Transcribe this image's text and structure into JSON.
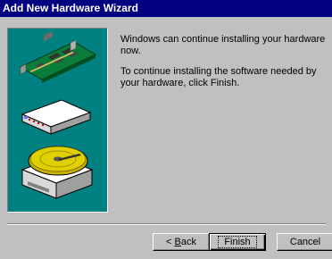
{
  "window": {
    "title": "Add New Hardware Wizard"
  },
  "message": {
    "line1": "Windows can continue installing your hardware now.",
    "line2": "To continue installing the software needed by your hardware, click Finish."
  },
  "buttons": {
    "back_prefix": "< ",
    "back_mnemonic": "B",
    "back_rest": "ack",
    "finish": "Finish",
    "cancel": "Cancel"
  },
  "icons": {
    "expansion_card": "expansion-card-icon",
    "modem": "modem-icon",
    "disk": "hard-disk-icon"
  },
  "colors": {
    "title_bar": "#000080",
    "panel": "#008080",
    "dialog": "#c0c0c0"
  }
}
